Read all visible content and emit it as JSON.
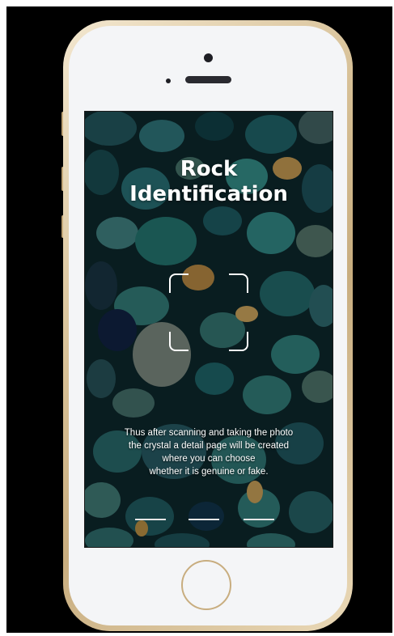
{
  "app": {
    "title_line1": "Rock",
    "title_line2": "Identification"
  },
  "onboarding": {
    "description_lines": [
      "Thus after scanning and taking the photo",
      "the crystal a detail page will be created",
      "where you can choose",
      "whether it is genuine or fake."
    ],
    "page_indicators": 3
  },
  "device": {
    "frame_color": "#d6bf95",
    "screen_background": "#0c2a2e"
  },
  "icons": {
    "scan_frame": "scan-frame-icon",
    "home_button": "home-button-icon"
  }
}
